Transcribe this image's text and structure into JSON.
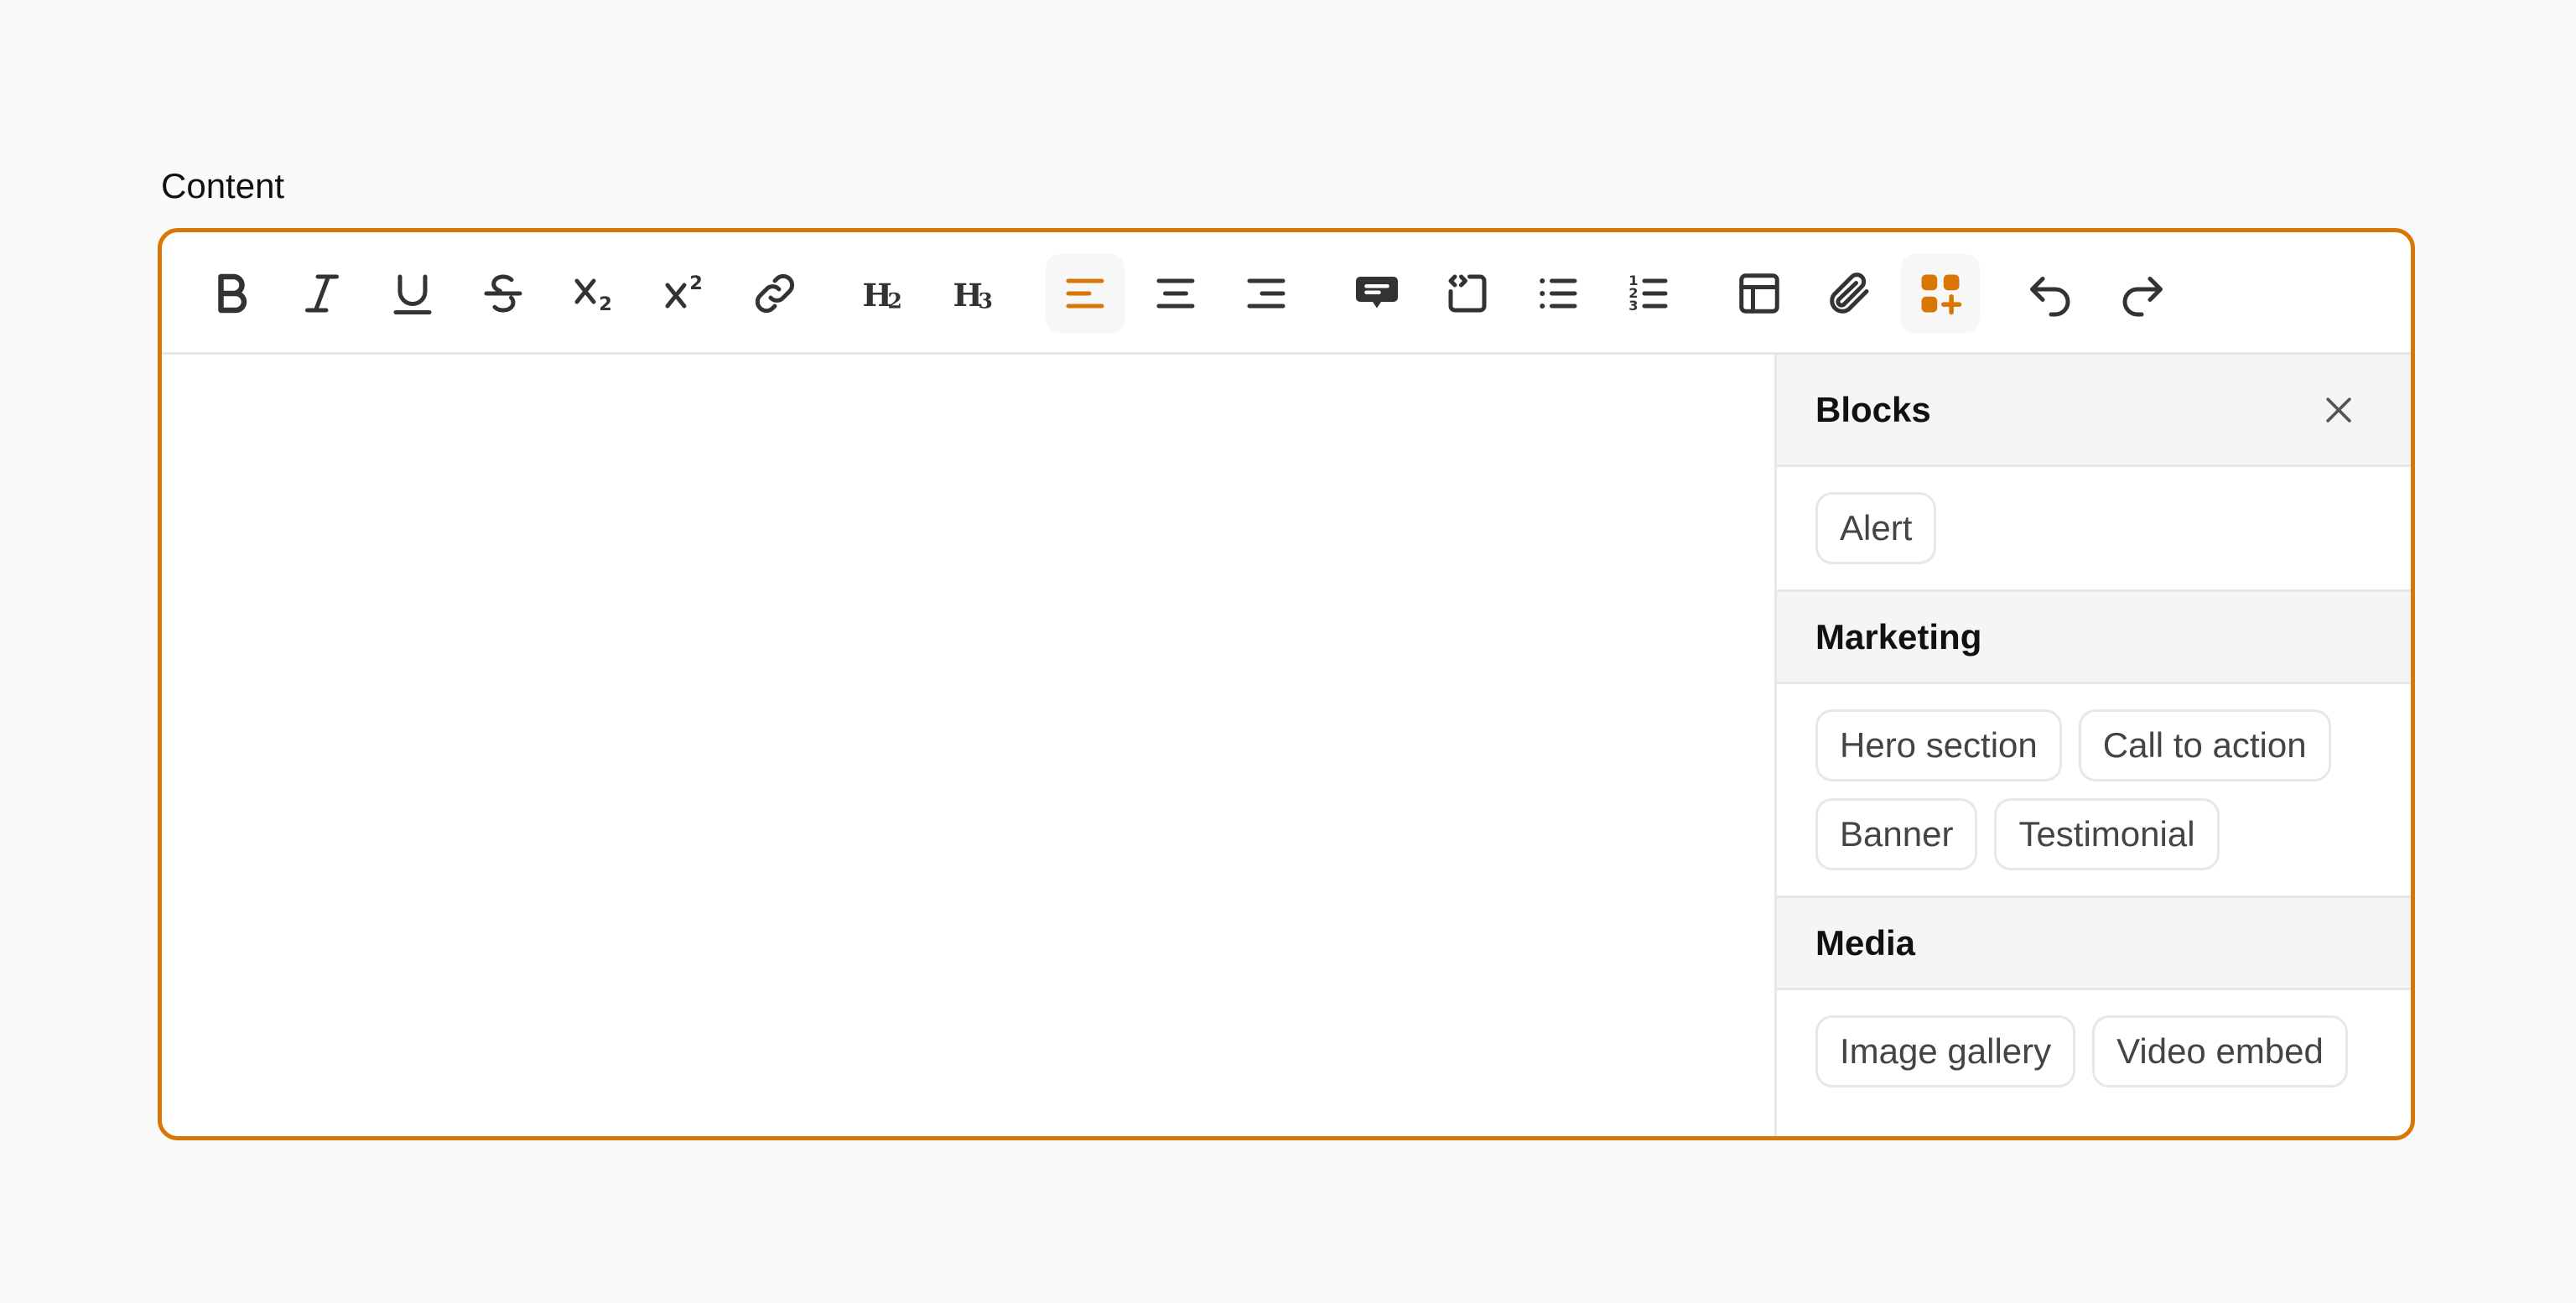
{
  "field_label": "Content",
  "accent_color": "#d97706",
  "toolbar": {
    "buttons": [
      {
        "icon": "bold-icon"
      },
      {
        "icon": "italic-icon"
      },
      {
        "icon": "underline-icon"
      },
      {
        "icon": "strikethrough-icon"
      },
      {
        "icon": "subscript-icon"
      },
      {
        "icon": "superscript-icon"
      },
      {
        "icon": "link-icon"
      },
      {
        "icon": "heading-2-icon"
      },
      {
        "icon": "heading-3-icon"
      },
      {
        "icon": "align-left-icon",
        "active": true
      },
      {
        "icon": "align-center-icon"
      },
      {
        "icon": "align-right-icon"
      },
      {
        "icon": "quote-icon"
      },
      {
        "icon": "code-block-icon"
      },
      {
        "icon": "bullet-list-icon"
      },
      {
        "icon": "ordered-list-icon"
      },
      {
        "icon": "table-icon"
      },
      {
        "icon": "attach-icon"
      },
      {
        "icon": "add-block-icon",
        "active": true
      },
      {
        "icon": "undo-icon"
      },
      {
        "icon": "redo-icon"
      }
    ]
  },
  "panel": {
    "title": "Blocks",
    "groups": [
      {
        "title": "",
        "items": [
          "Alert"
        ]
      },
      {
        "title": "Marketing",
        "items": [
          "Hero section",
          "Call to action",
          "Banner",
          "Testimonial"
        ]
      },
      {
        "title": "Media",
        "items": [
          "Image gallery",
          "Video embed"
        ]
      }
    ]
  }
}
